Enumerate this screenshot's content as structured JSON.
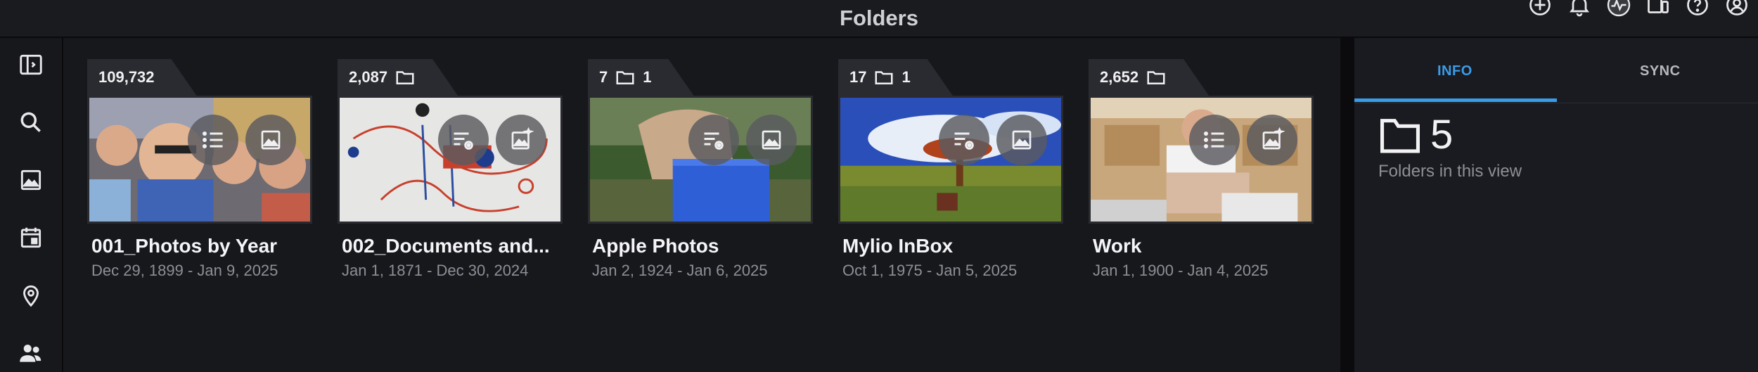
{
  "app": {
    "title": "Folders"
  },
  "top_icons": [
    "add-circle-icon",
    "bell-icon",
    "activity-icon",
    "devices-icon",
    "help-icon",
    "account-icon"
  ],
  "rail": [
    "sidebar-toggle-icon",
    "search-icon",
    "photos-icon",
    "calendar-icon",
    "map-pin-icon",
    "people-icon"
  ],
  "folders": [
    {
      "count": "109,732",
      "subfolders": "",
      "title": "001_Photos by Year",
      "dates": "Dec 29, 1899 - Jan 9, 2025",
      "has_folder_icon": false
    },
    {
      "count": "2,087",
      "subfolders": "",
      "title": "002_Documents and...",
      "dates": "Jan 1, 1871 - Dec 30, 2024",
      "has_folder_icon": true
    },
    {
      "count": "7",
      "subfolders": "1",
      "title": "Apple Photos",
      "dates": "Jan 2, 1924 - Jan 6, 2025",
      "has_folder_icon": true
    },
    {
      "count": "17",
      "subfolders": "1",
      "title": "Mylio InBox",
      "dates": "Oct 1, 1975 - Jan 5, 2025",
      "has_folder_icon": true
    },
    {
      "count": "2,652",
      "subfolders": "",
      "title": "Work",
      "dates": "Jan 1, 1900 - Jan 4, 2025",
      "has_folder_icon": true
    }
  ],
  "panel": {
    "tabs": [
      {
        "label": "INFO",
        "active": true
      },
      {
        "label": "SYNC",
        "active": false
      }
    ],
    "folder_count": "5",
    "folder_count_label": "Folders in this view",
    "accent": "#3a9be8"
  }
}
